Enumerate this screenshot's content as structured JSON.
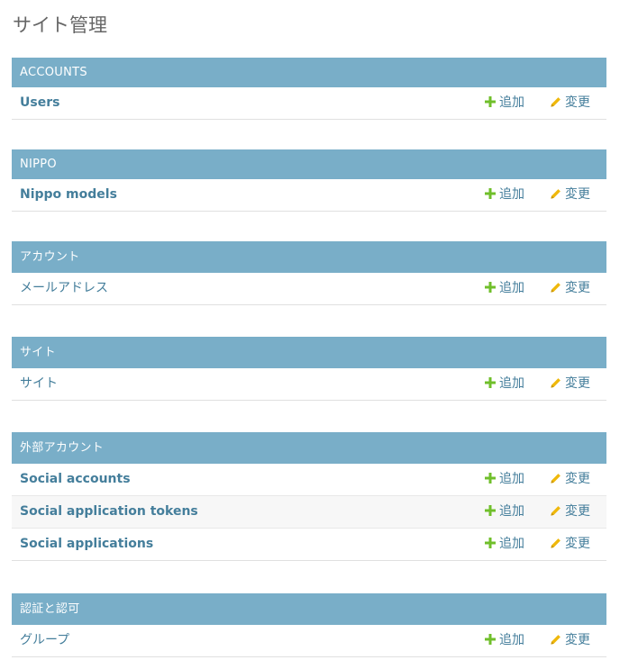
{
  "page": {
    "title": "サイト管理"
  },
  "labels": {
    "add": "追加",
    "change": "変更"
  },
  "colors": {
    "header_bg": "#79aec8",
    "link": "#447e9b",
    "add_icon": "#70bf2b",
    "change_icon": "#efb80b"
  },
  "icons": {
    "add": "plus-icon",
    "change": "pencil-icon"
  },
  "modules": [
    {
      "title": "ACCOUNTS",
      "models": [
        {
          "name": "Users"
        }
      ]
    },
    {
      "title": "NIPPO",
      "models": [
        {
          "name": "Nippo models"
        }
      ]
    },
    {
      "title": "アカウント",
      "models": [
        {
          "name": "メールアドレス"
        }
      ]
    },
    {
      "title": "サイト",
      "models": [
        {
          "name": "サイト"
        }
      ]
    },
    {
      "title": "外部アカウント",
      "models": [
        {
          "name": "Social accounts"
        },
        {
          "name": "Social application tokens"
        },
        {
          "name": "Social applications"
        }
      ]
    },
    {
      "title": "認証と認可",
      "models": [
        {
          "name": "グループ"
        }
      ]
    }
  ]
}
